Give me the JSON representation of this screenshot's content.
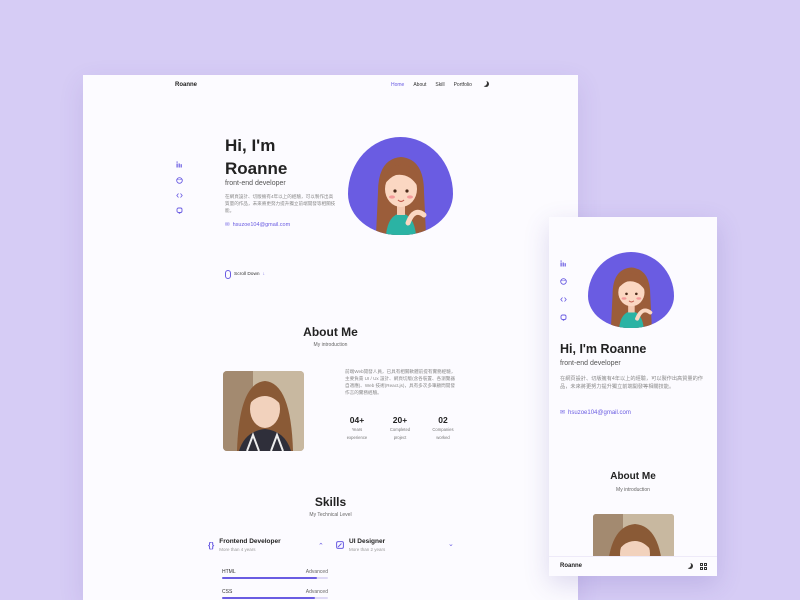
{
  "desktop": {
    "nav": {
      "brand": "Roanne",
      "items": [
        "Home",
        "About",
        "Skill",
        "Portfolio"
      ]
    },
    "hero": {
      "greeting_line1": "Hi, I'm",
      "greeting_line2": "Roanne",
      "role": "front-end developer",
      "description": "在網頁設計、切版擁有4年以上的經驗，可以製作出高質量的作品，未來將更努力提升獨立前端開發等相關技能。",
      "email": "hsuzoe104@gmail.com",
      "scroll_label": "Scroll Down"
    },
    "about": {
      "title": "About Me",
      "subtitle": "My introduction",
      "text": "前端Web開發人員，已具有相關軟體前提有實務經驗，主要負責 UI / Ux 設計、網頁切版(含各裝置、各瀏覽器自適應)、Web 技術(React.js)，具有多次多筆顧問開發作言的實務經驗。",
      "stats": [
        {
          "num": "04+",
          "label1": "Years",
          "label2": "experience"
        },
        {
          "num": "20+",
          "label1": "Completed",
          "label2": "project"
        },
        {
          "num": "02",
          "label1": "Companies",
          "label2": "worked"
        }
      ]
    },
    "skills": {
      "title": "Skills",
      "subtitle": "My Technical Level",
      "groups": [
        {
          "title": "Frontend Developer",
          "sub": "More than 4 years"
        },
        {
          "title": "UI Designer",
          "sub": "More than 2 years"
        }
      ],
      "bars": [
        {
          "name": "HTML",
          "level": "Advanced",
          "progress": 0.9
        },
        {
          "name": "CSS",
          "level": "Advanced",
          "progress": 0.88
        }
      ]
    }
  },
  "mobile": {
    "hero": {
      "greeting": "Hi, I'm Roanne",
      "role": "front-end developer",
      "description": "在網頁設計、切版擁有4年以上的經驗，可以製作出高質量的作品，未來將更努力提升獨立前端開發等相關技能。",
      "email": "hsuzoe104@gmail.com"
    },
    "about": {
      "title": "About Me",
      "subtitle": "My introduction"
    },
    "footer": {
      "brand": "Roanne"
    }
  },
  "colors": {
    "accent": "#6a5ce2",
    "background": "#d6ccf5",
    "card": "#fcfbff"
  },
  "icons": [
    "linkedin-icon",
    "dribbble-icon",
    "code-icon",
    "github-icon",
    "mail-icon",
    "mouse-icon",
    "arrow-down-icon",
    "moon-icon",
    "grid-menu-icon",
    "chevron-up-icon",
    "chevron-down-icon",
    "brackets-icon",
    "design-icon"
  ]
}
